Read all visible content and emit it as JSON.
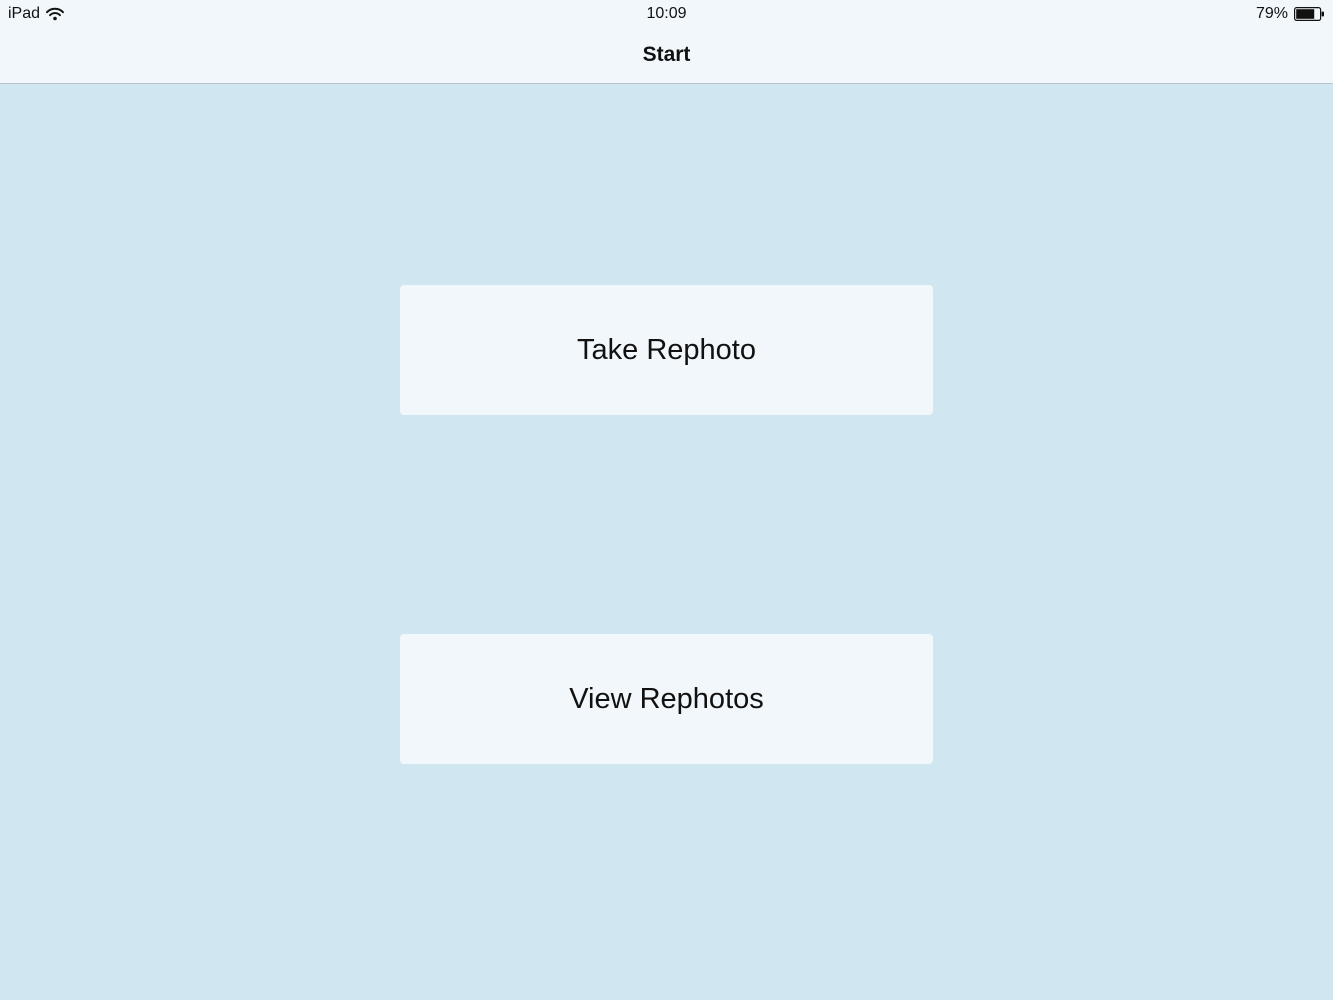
{
  "status_bar": {
    "device": "iPad",
    "time": "10:09",
    "battery_percent": "79%",
    "battery_level": 0.79,
    "wifi_icon": "wifi-icon",
    "battery_icon": "battery-icon"
  },
  "nav_bar": {
    "title": "Start"
  },
  "main": {
    "take_rephoto_label": "Take Rephoto",
    "view_rephotos_label": "View Rephotos"
  },
  "colors": {
    "background": "#d0e6f1",
    "bar_background": "#f1f7fa",
    "button_background": "#f1f7fa",
    "text": "#111111"
  }
}
